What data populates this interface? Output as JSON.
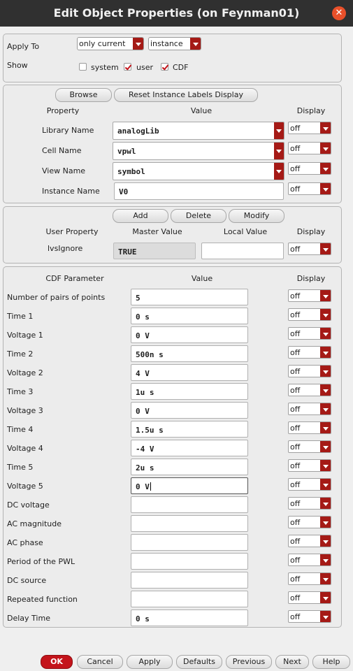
{
  "window": {
    "title": "Edit Object Properties (on Feynman01)",
    "close_icon": "close-icon"
  },
  "apply": {
    "apply_to_label": "Apply To",
    "apply_to_scope": "only current",
    "apply_to_type": "instance",
    "show_label": "Show",
    "show_options": [
      {
        "label": "system",
        "checked": false
      },
      {
        "label": "user",
        "checked": true
      },
      {
        "label": "CDF",
        "checked": true
      }
    ]
  },
  "instance": {
    "browse_label": "Browse",
    "reset_label": "Reset Instance Labels Display",
    "headers": {
      "property": "Property",
      "value": "Value",
      "display": "Display"
    },
    "rows": [
      {
        "label": "Library Name",
        "value": "analogLib",
        "display": "off"
      },
      {
        "label": "Cell Name",
        "value": "vpwl",
        "display": "off"
      },
      {
        "label": "View Name",
        "value": "symbol",
        "display": "off"
      },
      {
        "label": "Instance Name",
        "value": "V0",
        "display": "off"
      }
    ]
  },
  "user_props": {
    "add_label": "Add",
    "delete_label": "Delete",
    "modify_label": "Modify",
    "headers": {
      "property": "User Property",
      "master": "Master Value",
      "local": "Local Value",
      "display": "Display"
    },
    "rows": [
      {
        "name": "lvsIgnore",
        "master": "TRUE",
        "local": "",
        "display": "off"
      }
    ]
  },
  "cdf": {
    "headers": {
      "param": "CDF Parameter",
      "value": "Value",
      "display": "Display"
    },
    "rows": [
      {
        "label": "Number of pairs of points",
        "value": "5",
        "display": "off"
      },
      {
        "label": "Time 1",
        "value": "0 s",
        "display": "off"
      },
      {
        "label": "Voltage 1",
        "value": "0 V",
        "display": "off"
      },
      {
        "label": "Time 2",
        "value": "500n s",
        "display": "off"
      },
      {
        "label": "Voltage 2",
        "value": "4 V",
        "display": "off"
      },
      {
        "label": "Time 3",
        "value": "1u s",
        "display": "off"
      },
      {
        "label": "Voltage 3",
        "value": "0 V",
        "display": "off"
      },
      {
        "label": "Time 4",
        "value": "1.5u s",
        "display": "off"
      },
      {
        "label": "Voltage 4",
        "value": "-4 V",
        "display": "off"
      },
      {
        "label": "Time 5",
        "value": "2u s",
        "display": "off"
      },
      {
        "label": "Voltage 5",
        "value": "0 V",
        "display": "off"
      },
      {
        "label": "DC voltage",
        "value": "",
        "display": "off"
      },
      {
        "label": "AC magnitude",
        "value": "",
        "display": "off"
      },
      {
        "label": "AC phase",
        "value": "",
        "display": "off"
      },
      {
        "label": "Period of the PWL",
        "value": "",
        "display": "off"
      },
      {
        "label": "DC source",
        "value": "",
        "display": "off"
      },
      {
        "label": "Repeated function",
        "value": "",
        "display": "off"
      },
      {
        "label": "Delay Time",
        "value": "0 s",
        "display": "off"
      }
    ]
  },
  "footer": {
    "ok": "OK",
    "cancel": "Cancel",
    "apply": "Apply",
    "defaults": "Defaults",
    "previous": "Previous",
    "next": "Next",
    "help": "Help"
  },
  "colors": {
    "accent": "#a51a16",
    "ok_button": "#c4141b",
    "titlebar": "#303030",
    "close": "#e9502a"
  }
}
